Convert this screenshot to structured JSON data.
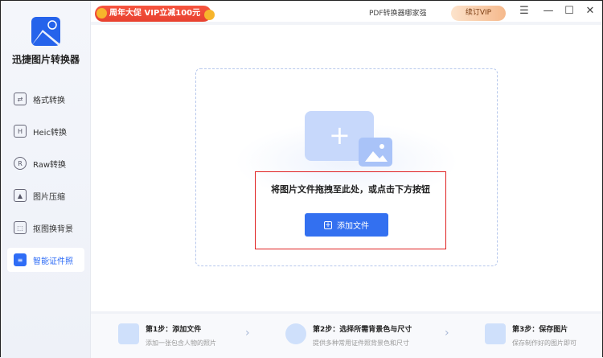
{
  "app": {
    "name": "迅捷图片转换器"
  },
  "sidebar": {
    "items": [
      {
        "label": "格式转换",
        "icon": "format-convert-icon",
        "glyph": "⇄"
      },
      {
        "label": "Heic转换",
        "icon": "heic-icon",
        "glyph": "H"
      },
      {
        "label": "Raw转换",
        "icon": "raw-icon",
        "glyph": "R"
      },
      {
        "label": "图片压缩",
        "icon": "image-compress-icon",
        "glyph": "▲"
      },
      {
        "label": "抠图换背景",
        "icon": "cutout-icon",
        "glyph": "⬚"
      },
      {
        "label": "智能证件照",
        "icon": "id-photo-icon",
        "glyph": "≡"
      }
    ],
    "active": 5
  },
  "topbar": {
    "promo": "周年大促 VIP立减100元",
    "pdf_link": "PDF转换器哪家强",
    "vip_button": "续订VIP",
    "menu_glyph": "☰",
    "min_glyph": "—",
    "max_glyph": "☐",
    "close_glyph": "✕"
  },
  "main": {
    "hint": "将图片文件拖拽至此处，或点击下方按钮",
    "add_button": "添加文件",
    "plus": "+"
  },
  "steps": [
    {
      "title": "第1步：添加文件",
      "desc": "添加一张包含人物的照片"
    },
    {
      "title": "第2步：选择所需背景色与尺寸",
      "desc": "提供多种常用证件照背景色和尺寸"
    },
    {
      "title": "第3步：保存图片",
      "desc": "保存制作好的图片即可"
    }
  ],
  "colors": {
    "accent": "#3370f0",
    "promo": "#e8412f",
    "border": "#e02020"
  }
}
